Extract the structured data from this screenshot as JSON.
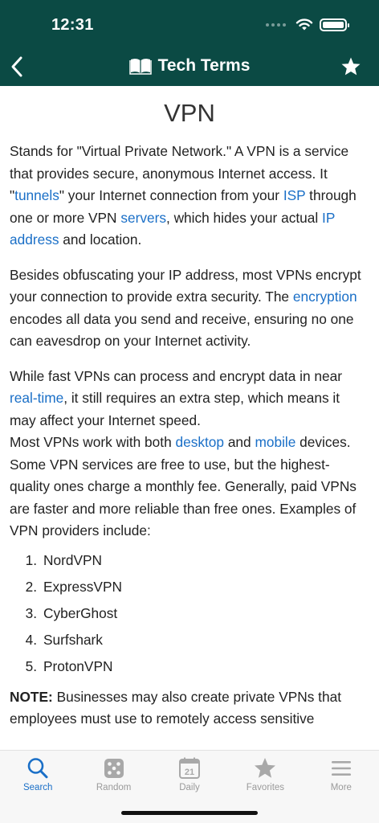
{
  "status": {
    "time": "12:31"
  },
  "header": {
    "title": "Tech Terms"
  },
  "term": {
    "title": "VPN"
  },
  "content": {
    "p1": {
      "t1": "Stands for \"Virtual Private Network.\" A VPN is a service that provides secure, anonymous Internet access. It \"",
      "link1": "tunnels",
      "t2": "\" your Internet connection from your ",
      "link2": "ISP",
      "t3": " through one or more VPN ",
      "link3": "servers",
      "t4": ", which hides your actual ",
      "link4": "IP address",
      "t5": " and location."
    },
    "p2": {
      "t1": "Besides obfuscating your IP address, most VPNs encrypt your connection to provide extra security. The ",
      "link1": "encryption",
      "t2": " encodes all data you send and receive, ensuring no one can eavesdrop on your Internet activity."
    },
    "p3": {
      "t1": "While fast VPNs can process and encrypt data in near ",
      "link1": "real-time",
      "t2": ", it still requires an extra step, which means it may affect your Internet speed."
    },
    "p4": {
      "t1": "Most VPNs work with both ",
      "link1": "desktop",
      "t2": " and ",
      "link2": "mobile",
      "t3": " devices. Some VPN services are free to use, but the highest-quality ones charge a monthly fee. Generally, paid VPNs are faster and more reliable than free ones. Examples of VPN providers include:"
    },
    "providers": [
      {
        "num": "1.",
        "name": "NordVPN"
      },
      {
        "num": "2.",
        "name": "ExpressVPN"
      },
      {
        "num": "3.",
        "name": "CyberGhost"
      },
      {
        "num": "4.",
        "name": "Surfshark"
      },
      {
        "num": "5.",
        "name": "ProtonVPN"
      }
    ],
    "note": {
      "label": "NOTE:",
      "text": " Businesses may also create private VPNs that employees must use to remotely access sensitive"
    }
  },
  "tabs": [
    {
      "label": "Search",
      "icon": "search-icon",
      "active": true
    },
    {
      "label": "Random",
      "icon": "dice-icon",
      "active": false
    },
    {
      "label": "Daily",
      "icon": "calendar-icon",
      "active": false,
      "date": "21"
    },
    {
      "label": "Favorites",
      "icon": "star-icon",
      "active": false
    },
    {
      "label": "More",
      "icon": "menu-icon",
      "active": false
    }
  ],
  "colors": {
    "header": "#0b4a44",
    "link": "#1a6fc7",
    "active_tab": "#1a6fc7",
    "inactive_tab": "#9a9a9a"
  }
}
